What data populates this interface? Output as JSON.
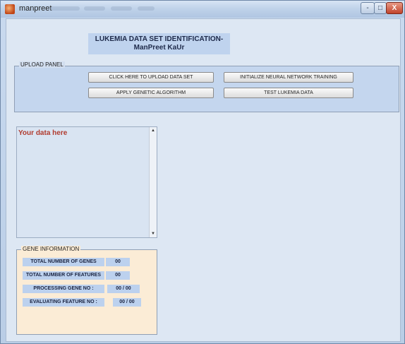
{
  "window": {
    "title": "manpreet",
    "controls": {
      "minimize": "-",
      "maximize": "□",
      "close": "X"
    }
  },
  "header": {
    "line1": "LUKEMIA DATA SET IDENTIFICATION-",
    "line2": "ManPreet KaUr"
  },
  "upload_panel": {
    "title": "UPLOAD PANEL",
    "buttons": {
      "upload": "CLICK HERE TO UPLOAD DATA SET",
      "init_nn": "INITIALIZE NEURAL NETWORK TRAINING",
      "genetic": "APPLY GENETIC ALGORITHM",
      "test": "TEST LUKEMIA DATA"
    }
  },
  "data_area": {
    "text": "Your data here"
  },
  "gene_info": {
    "title": "GENE INFORMATION",
    "rows": [
      {
        "label": "TOTAL NUMBER OF GENES",
        "value": "00"
      },
      {
        "label": "TOTAL NUMBER OF FEATURES",
        "value": "00"
      },
      {
        "label": "PROCESSING GENE NO :",
        "value": "00 / 00"
      },
      {
        "label": "EVALUATING FEATURE NO :",
        "value": "00 / 00"
      }
    ]
  },
  "icons": {
    "app": "matlab-app-icon",
    "scroll_up": "chevron-up-icon",
    "scroll_down": "chevron-down-icon"
  }
}
